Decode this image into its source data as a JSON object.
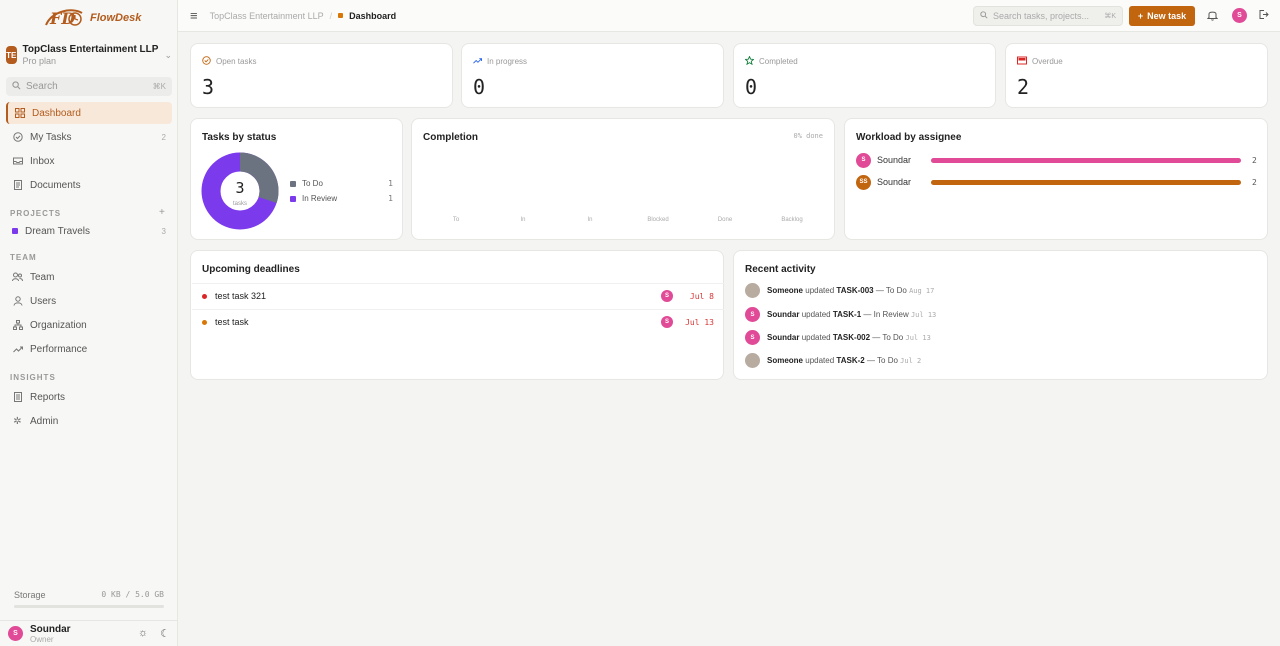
{
  "brand": {
    "name": "FlowDesk"
  },
  "workspace": {
    "initials": "TE",
    "name": "TopClass Entertainment LLP",
    "plan": "Pro plan"
  },
  "sidebar": {
    "search_placeholder": "Search",
    "search_shortcut": "⌘K",
    "items": [
      {
        "label": "Dashboard",
        "icon": "grid-icon",
        "active": true
      },
      {
        "label": "My Tasks",
        "icon": "check-circle-icon",
        "count": "2"
      },
      {
        "label": "Inbox",
        "icon": "inbox-icon"
      },
      {
        "label": "Documents",
        "icon": "document-icon"
      }
    ],
    "projects_title": "PROJECTS",
    "projects": [
      {
        "label": "Dream Travels",
        "count": "3",
        "color": "#7c3aed"
      }
    ],
    "team_title": "TEAM",
    "team_items": [
      {
        "label": "Team",
        "icon": "team-icon"
      },
      {
        "label": "Users",
        "icon": "user-icon"
      },
      {
        "label": "Organization",
        "icon": "org-icon"
      },
      {
        "label": "Performance",
        "icon": "trend-icon"
      }
    ],
    "insights_title": "INSIGHTS",
    "insights_items": [
      {
        "label": "Reports",
        "icon": "report-icon"
      },
      {
        "label": "Admin",
        "icon": "gear-icon"
      }
    ],
    "storage_label": "Storage",
    "storage_value": "0 KB / 5.0 GB",
    "storage_fraction": 0
  },
  "user": {
    "initial": "S",
    "name": "Soundar",
    "role": "Owner"
  },
  "topbar": {
    "breadcrumb_workspace": "TopClass Entertainment LLP",
    "breadcrumb_separator": "/",
    "breadcrumb_current": "Dashboard",
    "search_placeholder": "Search tasks, projects...",
    "search_shortcut": "⌘K",
    "new_task_label": "New task",
    "avatar_initial": "S"
  },
  "stats": [
    {
      "label": "Open tasks",
      "value": "3",
      "icon": "check-circle-icon"
    },
    {
      "label": "In progress",
      "value": "0",
      "icon": "trend-up-icon"
    },
    {
      "label": "Completed",
      "value": "0",
      "icon": "star-icon"
    },
    {
      "label": "Overdue",
      "value": "2",
      "icon": "alert-inbox-icon"
    }
  ],
  "tasks_by_status": {
    "title": "Tasks by status",
    "center_value": "3",
    "center_label": "tasks",
    "legend": [
      {
        "label": "To Do",
        "value": "1",
        "color": "#6b7280"
      },
      {
        "label": "In Review",
        "value": "1",
        "color": "#7c3aed"
      }
    ]
  },
  "completion": {
    "title": "Completion",
    "percent_label": "0% done",
    "categories": [
      "To",
      "In",
      "In",
      "Blocked",
      "Done",
      "Backlog"
    ]
  },
  "workload": {
    "title": "Workload by assignee",
    "rows": [
      {
        "initials": "S",
        "name": "Soundar",
        "count": "2",
        "fraction": 1,
        "color": "#e04a97"
      },
      {
        "initials": "SS",
        "name": "Soundar",
        "count": "2",
        "fraction": 1,
        "color": "#c2650f"
      }
    ]
  },
  "deadlines": {
    "title": "Upcoming deadlines",
    "rows": [
      {
        "title": "test task 321",
        "date": "Jul 8",
        "dot_color": "#dc2626",
        "assignee": "S"
      },
      {
        "title": "test task",
        "date": "Jul 13",
        "dot_color": "#d97706",
        "assignee": "S"
      }
    ]
  },
  "activity": {
    "title": "Recent activity",
    "rows": [
      {
        "actor": "Someone",
        "verb": "updated",
        "task": "TASK-003",
        "status": "— To Do",
        "date": "Aug 17",
        "initials": "",
        "avatar_color": "#b8aba0"
      },
      {
        "actor": "Soundar",
        "verb": "updated",
        "task": "TASK-1",
        "status": "— In Review",
        "date": "Jul 13",
        "initials": "S",
        "avatar_color": "#e04a97"
      },
      {
        "actor": "Soundar",
        "verb": "updated",
        "task": "TASK-002",
        "status": "— To Do",
        "date": "Jul 13",
        "initials": "S",
        "avatar_color": "#e04a97"
      },
      {
        "actor": "Someone",
        "verb": "updated",
        "task": "TASK-2",
        "status": "— To Do",
        "date": "Jul 2",
        "initials": "",
        "avatar_color": "#b8aba0"
      }
    ]
  },
  "colors": {
    "accent": "#c2650f",
    "todo": "#6b7280",
    "review": "#7c3aed"
  }
}
